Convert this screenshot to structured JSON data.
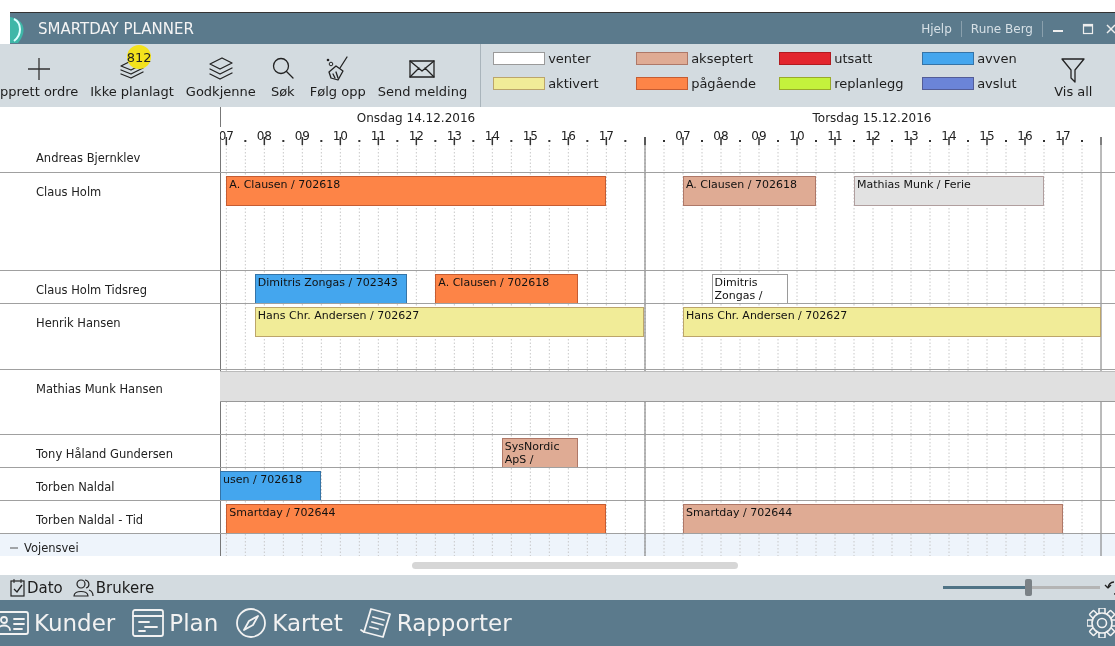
{
  "window": {
    "title": "SMARTDAY PLANNER",
    "links": [
      "Hjelp",
      "Rune Berg"
    ]
  },
  "toolbar": {
    "buttons": [
      {
        "label": "pprett ordre"
      },
      {
        "label": "Ikke planlagt",
        "badge": "812"
      },
      {
        "label": "Godkjenne"
      },
      {
        "label": "Søk"
      },
      {
        "label": "Følg opp"
      },
      {
        "label": "Send melding"
      }
    ],
    "legend": [
      {
        "label": "venter",
        "color": "#ffffff"
      },
      {
        "label": "akseptert",
        "color": "#dfab94"
      },
      {
        "label": "utsatt",
        "color": "#e3262e"
      },
      {
        "label": "avven",
        "color": "#44a6ee"
      },
      {
        "label": "aktivert",
        "color": "#f1ec98"
      },
      {
        "label": "pågående",
        "color": "#fd8447"
      },
      {
        "label": "replanlegg",
        "color": "#c4f23c"
      },
      {
        "label": "avslut",
        "color": "#6b84d8"
      }
    ],
    "filter": {
      "label": "Vis all"
    }
  },
  "gantt": {
    "days": [
      {
        "label": "Onsdag 14.12.2016",
        "hours": [
          "07",
          "08",
          "09",
          "10",
          "11",
          "12",
          "13",
          "14",
          "15",
          "16",
          "17"
        ]
      },
      {
        "label": "Torsdag 15.12.2016",
        "hours": [
          "07",
          "08",
          "09",
          "10",
          "11",
          "12",
          "13",
          "14",
          "15",
          "16",
          "17"
        ]
      }
    ],
    "rows": [
      {
        "name": "Andreas Bjernklev"
      },
      {
        "name": "Claus Holm",
        "bars": [
          {
            "kind": "booking",
            "label": "A. Clausen / 702618",
            "color": "#fd8447"
          },
          {
            "kind": "booking",
            "label": "A. Clausen / 702618",
            "color": "#dfab94"
          },
          {
            "kind": "booking",
            "label": "Mathias Munk / Ferie",
            "color": "#e2e2e2"
          }
        ]
      },
      {
        "name": "Claus Holm Tidsreg",
        "bars": [
          {
            "kind": "booking",
            "label": "Dimitris Zongas / 702343",
            "color": "#44a6ee"
          },
          {
            "kind": "booking",
            "label": "A. Clausen / 702618",
            "color": "#fd8447"
          },
          {
            "kind": "booking",
            "label": "Dimitris Zongas /",
            "color": "#ffffff"
          }
        ]
      },
      {
        "name": "Henrik Hansen",
        "bars": [
          {
            "kind": "booking",
            "label": "Hans Chr. Andersen / 702627",
            "color": "#f1ec98"
          },
          {
            "kind": "booking",
            "label": "Hans Chr. Andersen / 702627",
            "color": "#f1ec98"
          }
        ]
      },
      {
        "name": "Mathias Munk Hansen",
        "bars": [
          {
            "kind": "band",
            "color": "#e0e0e0"
          }
        ]
      },
      {
        "name": "Tony Håland Gundersen",
        "bars": [
          {
            "kind": "booking",
            "label": "SysNordic ApS /",
            "color": "#dfab94"
          }
        ]
      },
      {
        "name": "Torben Naldal",
        "bars": [
          {
            "kind": "booking",
            "label": "usen / 702618",
            "color": "#44a6ee"
          }
        ]
      },
      {
        "name": "Torben Naldal - Tid",
        "bars": [
          {
            "kind": "booking",
            "label": "Smartday / 702644",
            "color": "#fd8447"
          },
          {
            "kind": "booking",
            "label": "Smartday / 702644",
            "color": "#dfab94"
          }
        ]
      }
    ],
    "group": {
      "name": "Vojensvei",
      "expanded": true
    }
  },
  "statusbar": {
    "tabs": [
      {
        "label": "Dato"
      },
      {
        "label": "Brukere"
      }
    ],
    "zoom": {
      "level": 0.54
    }
  },
  "nav": {
    "items": [
      {
        "label": "Kunder"
      },
      {
        "label": "Plan"
      },
      {
        "label": "Kartet"
      },
      {
        "label": "Rapporter"
      }
    ]
  }
}
